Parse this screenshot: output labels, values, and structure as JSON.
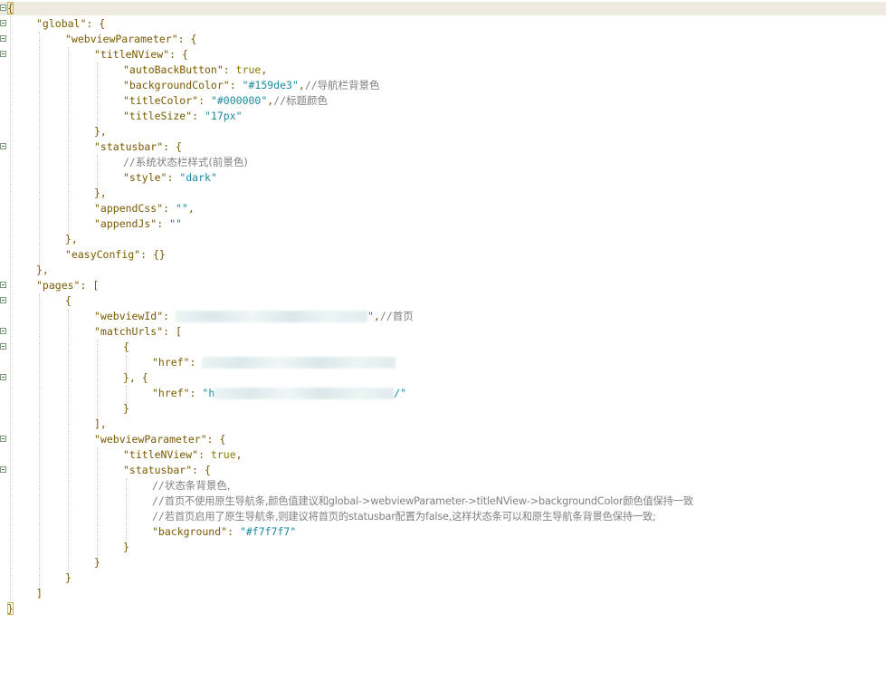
{
  "code": {
    "global_key": "\"global\"",
    "webviewParameter_key": "\"webviewParameter\"",
    "titleNView_key": "\"titleNView\"",
    "autoBackButton_key": "\"autoBackButton\"",
    "autoBackButton_val": "true",
    "backgroundColor_key": "\"backgroundColor\"",
    "backgroundColor_val": "\"#159de3\"",
    "backgroundColor_comment": "导航栏背景色",
    "titleColor_key": "\"titleColor\"",
    "titleColor_val": "\"#000000\"",
    "titleColor_comment": "标题颜色",
    "titleSize_key": "\"titleSize\"",
    "titleSize_val": "\"17px\"",
    "statusbar_key": "\"statusbar\"",
    "statusbar_comment": "系统状态栏样式(前景色)",
    "style_key": "\"style\"",
    "style_val": "\"dark\"",
    "appendCss_key": "\"appendCss\"",
    "appendCss_val": "\"\"",
    "appendJs_key": "\"appendJs\"",
    "appendJs_val": "\"\"",
    "easyConfig_key": "\"easyConfig\"",
    "easyConfig_val": "{}",
    "pages_key": "\"pages\"",
    "webviewId_key": "\"webviewId\"",
    "webviewId_tail": "\"",
    "webviewId_comment": "首页",
    "matchUrls_key": "\"matchUrls\"",
    "href_key": "\"href\"",
    "href2_head": "\"h",
    "href2_tail": "/\"",
    "titleNView_val": "true",
    "statusbar_comment1": "状态条背景色,",
    "statusbar_comment2": "首页不使用原生导航条,颜色值建议和global->webviewParameter->titleNView->backgroundColor颜色值保持一致",
    "statusbar_comment3": "若首页启用了原生导航条,则建议将首页的statusbar配置为false,这样状态条可以和原生导航条背景色保持一致;",
    "background_key": "\"background\"",
    "background_val": "\"#f7f7f7\""
  },
  "colors": {
    "key": "#7a5a00",
    "string": "#1a8aa0",
    "boolean": "#8a7a00",
    "comment": "#808080",
    "active_line": "#efeadf"
  }
}
